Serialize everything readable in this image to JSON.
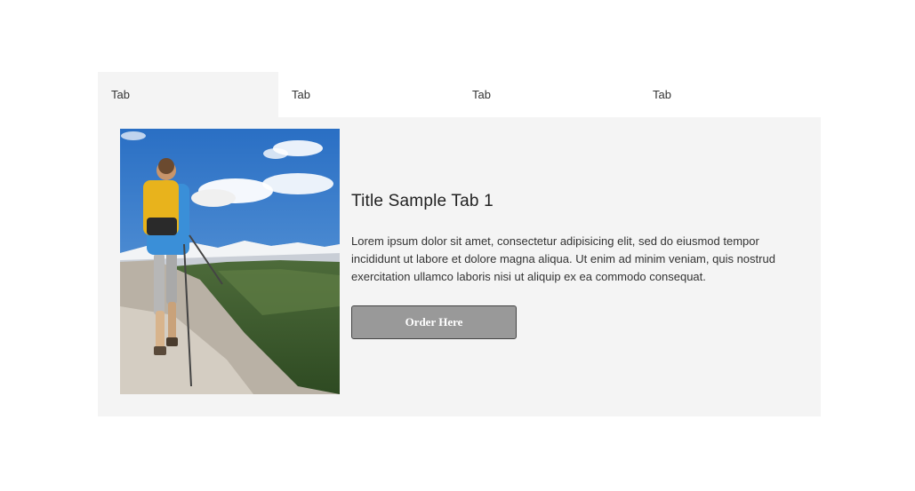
{
  "tabs": [
    {
      "label": "Tab",
      "active": true
    },
    {
      "label": "Tab",
      "active": false
    },
    {
      "label": "Tab",
      "active": false
    },
    {
      "label": "Tab",
      "active": false
    }
  ],
  "panel": {
    "image_alt": "hiker-with-backpack-photo",
    "title": "Title Sample Tab 1",
    "body": "Lorem ipsum dolor sit amet, consectetur adipisicing elit, sed do eiusmod tempor incididunt ut labore et dolore magna aliqua. Ut enim ad minim veniam, quis nostrud exercitation ullamco laboris nisi ut aliquip ex ea commodo consequat.",
    "button_label": "Order Here"
  },
  "colors": {
    "panel_bg": "#f4f4f4",
    "button_bg": "#999999",
    "button_border": "#444444"
  }
}
